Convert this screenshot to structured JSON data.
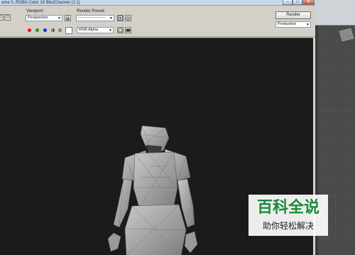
{
  "window": {
    "title": "ame 0, RGBA Color 16 Bits/Channel (1:1)",
    "min_glyph": "─",
    "max_glyph": "□",
    "close_glyph": "✕"
  },
  "toolbar": {
    "area_glyph": "⊡",
    "viewport_label": "Viewport:",
    "viewport_value": "Perspective",
    "preset_label": "Render Preset:",
    "preset_value": "---------------------",
    "render_label": "Render",
    "production_value": "Production",
    "channel_value": "RGB Alpha",
    "dropdown_arrow": "▼"
  },
  "colors": {
    "red": "#e01010",
    "green": "#10a010",
    "blue": "#1030d0",
    "accent_brand": "#1a8a3a"
  },
  "watermark": {
    "main_text": "百科全说",
    "sub_text": "助你轻松解决"
  },
  "icons": [
    "lock-icon",
    "environment-icon",
    "teapot-icon",
    "save-icon",
    "copy-icon",
    "clear-icon",
    "display-icon"
  ]
}
